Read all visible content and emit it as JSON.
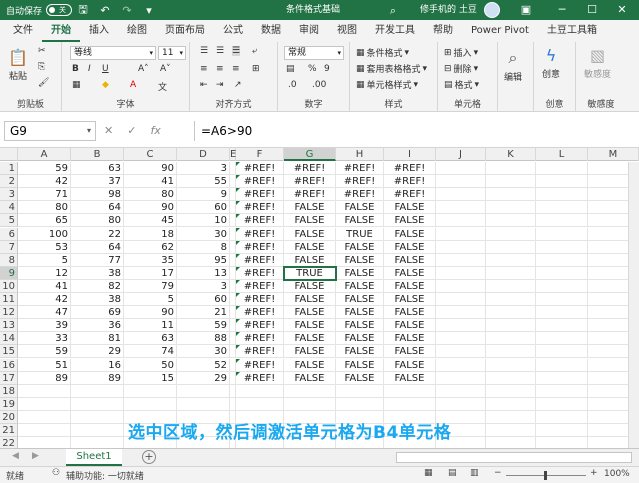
{
  "titlebar": {
    "autosave_label": "自动保存",
    "toggle_label": "关",
    "doc_title": "条件格式基础",
    "user_name": "修手机的 土豆"
  },
  "tabs": [
    "文件",
    "开始",
    "插入",
    "绘图",
    "页面布局",
    "公式",
    "数据",
    "审阅",
    "视图",
    "开发工具",
    "帮助",
    "Power Pivot",
    "土豆工具箱"
  ],
  "ribbon": {
    "clipboard": {
      "label": "剪贴板",
      "paste": "粘贴"
    },
    "font": {
      "label": "字体",
      "name": "等线",
      "size": "11"
    },
    "alignment": {
      "label": "对齐方式"
    },
    "number": {
      "label": "数字",
      "format": "常规"
    },
    "styles": {
      "label": "样式",
      "conditional": "条件格式",
      "table": "套用表格格式",
      "cell": "单元格样式"
    },
    "cells": {
      "label": "单元格",
      "insert": "插入",
      "delete": "删除",
      "format": "格式"
    },
    "editing": {
      "label": "",
      "edit": "编辑"
    },
    "creative": {
      "label": "创意",
      "create": "创意"
    },
    "sensitivity": {
      "label": "敏感度",
      "btn": "敏感度"
    }
  },
  "formula_bar": {
    "name_box": "G9",
    "formula": "=A6>90"
  },
  "columns": [
    "A",
    "B",
    "C",
    "D",
    "E",
    "F",
    "G",
    "H",
    "I",
    "J",
    "K",
    "L",
    "M"
  ],
  "selected_column": "G",
  "selected_row": 9,
  "rows": [
    {
      "n": "1",
      "a": "59",
      "b": "63",
      "c": "90",
      "d": "3",
      "f": "#REF!",
      "g": "#REF!",
      "h": "#REF!",
      "i": "#REF!"
    },
    {
      "n": "2",
      "a": "42",
      "b": "37",
      "c": "41",
      "d": "55",
      "f": "#REF!",
      "g": "#REF!",
      "h": "#REF!",
      "i": "#REF!"
    },
    {
      "n": "3",
      "a": "71",
      "b": "98",
      "c": "80",
      "d": "9",
      "f": "#REF!",
      "g": "#REF!",
      "h": "#REF!",
      "i": "#REF!"
    },
    {
      "n": "4",
      "a": "80",
      "b": "64",
      "c": "90",
      "d": "60",
      "f": "#REF!",
      "g": "FALSE",
      "h": "FALSE",
      "i": "FALSE"
    },
    {
      "n": "5",
      "a": "65",
      "b": "80",
      "c": "45",
      "d": "10",
      "f": "#REF!",
      "g": "FALSE",
      "h": "FALSE",
      "i": "FALSE"
    },
    {
      "n": "6",
      "a": "100",
      "b": "22",
      "c": "18",
      "d": "30",
      "f": "#REF!",
      "g": "FALSE",
      "h": "TRUE",
      "i": "FALSE"
    },
    {
      "n": "7",
      "a": "53",
      "b": "64",
      "c": "62",
      "d": "8",
      "f": "#REF!",
      "g": "FALSE",
      "h": "FALSE",
      "i": "FALSE"
    },
    {
      "n": "8",
      "a": "5",
      "b": "77",
      "c": "35",
      "d": "95",
      "f": "#REF!",
      "g": "FALSE",
      "h": "FALSE",
      "i": "FALSE"
    },
    {
      "n": "9",
      "a": "12",
      "b": "38",
      "c": "17",
      "d": "13",
      "f": "#REF!",
      "g": "TRUE",
      "h": "FALSE",
      "i": "FALSE"
    },
    {
      "n": "10",
      "a": "41",
      "b": "82",
      "c": "79",
      "d": "3",
      "f": "#REF!",
      "g": "FALSE",
      "h": "FALSE",
      "i": "FALSE"
    },
    {
      "n": "11",
      "a": "42",
      "b": "38",
      "c": "5",
      "d": "60",
      "f": "#REF!",
      "g": "FALSE",
      "h": "FALSE",
      "i": "FALSE"
    },
    {
      "n": "12",
      "a": "47",
      "b": "69",
      "c": "90",
      "d": "21",
      "f": "#REF!",
      "g": "FALSE",
      "h": "FALSE",
      "i": "FALSE"
    },
    {
      "n": "13",
      "a": "39",
      "b": "36",
      "c": "11",
      "d": "59",
      "f": "#REF!",
      "g": "FALSE",
      "h": "FALSE",
      "i": "FALSE"
    },
    {
      "n": "14",
      "a": "33",
      "b": "81",
      "c": "63",
      "d": "88",
      "f": "#REF!",
      "g": "FALSE",
      "h": "FALSE",
      "i": "FALSE"
    },
    {
      "n": "15",
      "a": "59",
      "b": "29",
      "c": "74",
      "d": "30",
      "f": "#REF!",
      "g": "FALSE",
      "h": "FALSE",
      "i": "FALSE"
    },
    {
      "n": "16",
      "a": "51",
      "b": "16",
      "c": "50",
      "d": "52",
      "f": "#REF!",
      "g": "FALSE",
      "h": "FALSE",
      "i": "FALSE"
    },
    {
      "n": "17",
      "a": "89",
      "b": "89",
      "c": "15",
      "d": "29",
      "f": "#REF!",
      "g": "FALSE",
      "h": "FALSE",
      "i": "FALSE"
    },
    {
      "n": "18"
    },
    {
      "n": "19"
    },
    {
      "n": "20"
    },
    {
      "n": "21"
    },
    {
      "n": "22"
    }
  ],
  "caption": "选中区域，然后调激活单元格为B4单元格",
  "sheet_tab": "Sheet1",
  "status": {
    "ready": "就绪",
    "accessibility": "辅助功能: 一切就绪",
    "zoom": "100%"
  },
  "colors": {
    "excel_green": "#217346",
    "caption_blue": "#1aa8f0"
  }
}
